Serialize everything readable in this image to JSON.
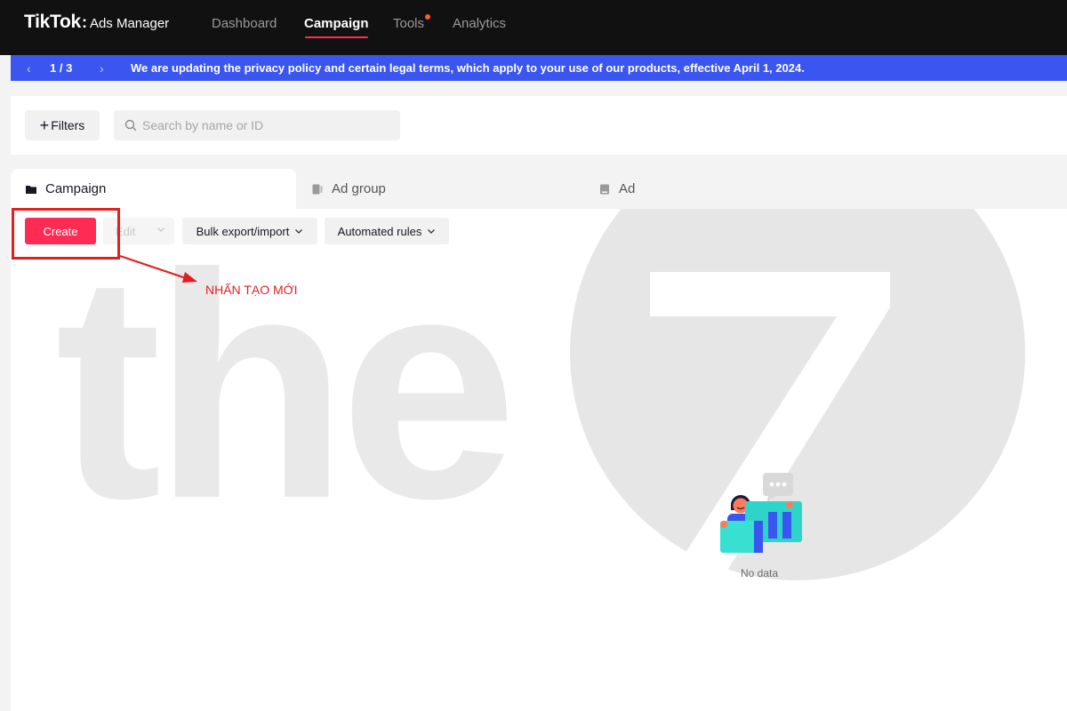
{
  "brand": {
    "logo": "TikTok",
    "colon": ":",
    "product": "Ads Manager"
  },
  "nav": {
    "items": [
      {
        "label": "Dashboard"
      },
      {
        "label": "Campaign"
      },
      {
        "label": "Tools"
      },
      {
        "label": "Analytics"
      }
    ]
  },
  "announcement": {
    "page": "1  /  3",
    "text": "We are updating the privacy policy and certain legal terms, which apply to your use of our products, effective April 1, 2024."
  },
  "toolbar_top": {
    "filters_label": "Filters",
    "search_placeholder": "Search by name or ID"
  },
  "tabs": [
    {
      "label": "Campaign"
    },
    {
      "label": "Ad group"
    },
    {
      "label": "Ad"
    }
  ],
  "actions": {
    "create": "Create",
    "edit": "Edit",
    "bulk": "Bulk export/import",
    "automated": "Automated rules"
  },
  "annotation": {
    "text": "NHẤN TẠO MỚI"
  },
  "watermark": {
    "text": "the"
  },
  "empty_state": {
    "text": "No data"
  },
  "colors": {
    "accent": "#fe2c55",
    "banner": "#3a55f0",
    "annotation": "#e02020"
  }
}
